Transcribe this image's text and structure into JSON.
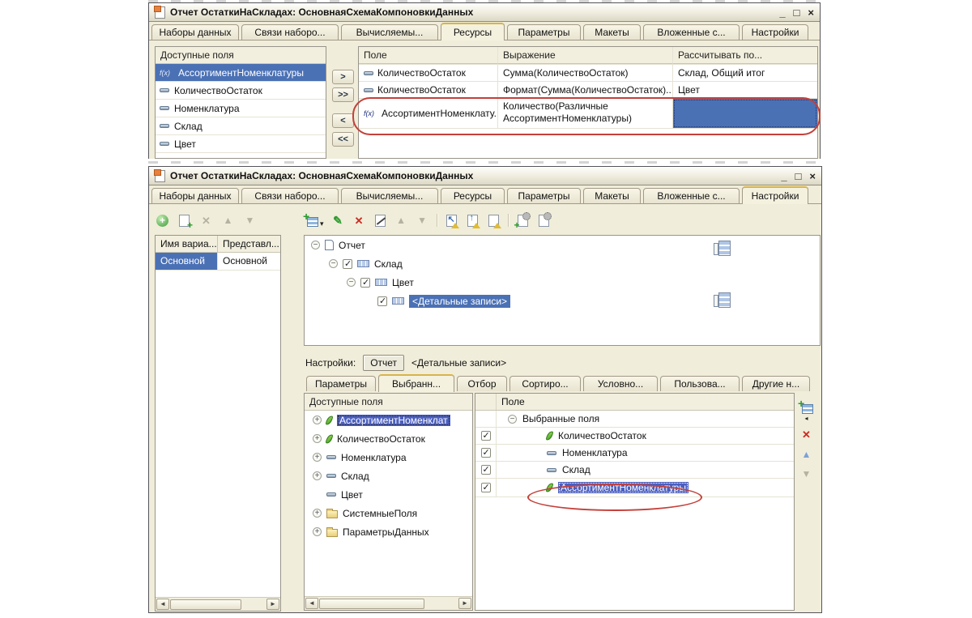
{
  "colors": {
    "selection_blue": "#4b71b5",
    "annotation_red": "#c4403a",
    "window_bg": "#f0edda",
    "tab_accent": "#d8b44a"
  },
  "window_controls": {
    "minimize": "_",
    "maximize": "□",
    "close": "×"
  },
  "function_icon_text": "f(x)",
  "top_window": {
    "title": "Отчет ОстаткиНаСкладах: ОсновнаяСхемаКомпоновкиДанных",
    "tabs": [
      "Наборы данных",
      "Связи наборо...",
      "Вычисляемы...",
      "Ресурсы",
      "Параметры",
      "Макеты",
      "Вложенные с...",
      "Настройки"
    ],
    "active_tab": "Ресурсы",
    "available_fields": {
      "header": "Доступные поля",
      "items": [
        {
          "icon": "function-icon",
          "label": "АссортиментНоменклатуры",
          "selected": true
        },
        {
          "icon": "attribute-icon",
          "label": "КоличествоОстаток"
        },
        {
          "icon": "attribute-icon",
          "label": "Номенклатура"
        },
        {
          "icon": "attribute-icon",
          "label": "Склад"
        },
        {
          "icon": "attribute-icon",
          "label": "Цвет"
        }
      ]
    },
    "transfer_buttons": {
      "move_right": ">",
      "move_all_right": ">>",
      "move_left": "<",
      "move_all_left": "<<"
    },
    "resources_table": {
      "columns": [
        "Поле",
        "Выражение",
        "Рассчитывать по..."
      ],
      "rows": [
        {
          "icon": "attribute-icon",
          "field": "КоличествоОстаток",
          "expression": "Сумма(КоличествоОстаток)",
          "calculate_by": "Склад, Общий итог"
        },
        {
          "icon": "attribute-icon",
          "field": "КоличествоОстаток",
          "expression": "Формат(Сумма(КоличествоОстаток)...",
          "calculate_by": "Цвет"
        },
        {
          "icon": "function-icon",
          "field": "АссортиментНоменклату...",
          "expression": "Количество(Различные АссортиментНоменклатуры)",
          "calculate_by": "",
          "selected": true,
          "annotated": true
        }
      ]
    }
  },
  "bottom_window": {
    "title": "Отчет ОстаткиНаСкладах: ОсновнаяСхемаКомпоновкиДанных",
    "tabs": [
      "Наборы данных",
      "Связи наборо...",
      "Вычисляемы...",
      "Ресурсы",
      "Параметры",
      "Макеты",
      "Вложенные с...",
      "Настройки"
    ],
    "active_tab": "Настройки",
    "variants_table": {
      "columns": [
        "Имя вариа...",
        "Представл..."
      ],
      "rows": [
        {
          "name": "Основной",
          "presentation": "Основной",
          "selected": true
        }
      ]
    },
    "structure_tree": {
      "items": [
        {
          "label": "Отчет",
          "icon": "report-icon",
          "expander": "minus",
          "stack_icon": true
        },
        {
          "label": "Склад",
          "icon": "grouping-icon",
          "expander": "minus",
          "checked": true
        },
        {
          "label": "Цвет",
          "icon": "grouping-icon",
          "expander": "minus",
          "checked": true
        },
        {
          "label": "<Детальные записи>",
          "icon": "grouping-icon",
          "checked": true,
          "selected": true,
          "stack_icon": true
        }
      ]
    },
    "settings_bar": {
      "label": "Настройки:",
      "scope_button": "Отчет",
      "current": "<Детальные записи>"
    },
    "settings_tabs": [
      "Параметры",
      "Выбранн...",
      "Отбор",
      "Сортиро...",
      "Условно...",
      "Пользова...",
      "Другие н..."
    ],
    "active_settings_tab": "Выбранн...",
    "available_fields": {
      "header": "Доступные поля",
      "items": [
        {
          "icon": "leaf-icon",
          "label": "АссортиментНоменклат",
          "expandable": true,
          "selected": true
        },
        {
          "icon": "leaf-icon",
          "label": "КоличествоОстаток",
          "expandable": true
        },
        {
          "icon": "attribute-icon",
          "label": "Номенклатура",
          "expandable": true
        },
        {
          "icon": "attribute-icon",
          "label": "Склад",
          "expandable": true
        },
        {
          "icon": "attribute-icon",
          "label": "Цвет",
          "expandable": false
        },
        {
          "icon": "folder-icon",
          "label": "СистемныеПоля",
          "expandable": true
        },
        {
          "icon": "folder-icon",
          "label": "ПараметрыДанных",
          "expandable": true
        }
      ]
    },
    "selected_fields": {
      "column": "Поле",
      "group_label": "Выбранные поля",
      "items": [
        {
          "icon": "leaf-icon",
          "label": "КоличествоОстаток",
          "checked": true
        },
        {
          "icon": "attribute-icon",
          "label": "Номенклатура",
          "checked": true
        },
        {
          "icon": "attribute-icon",
          "label": "Склад",
          "checked": true
        },
        {
          "icon": "leaf-icon",
          "label": "АссортиментНоменклатуры",
          "checked": true,
          "selected": true,
          "annotated": true
        }
      ]
    }
  }
}
